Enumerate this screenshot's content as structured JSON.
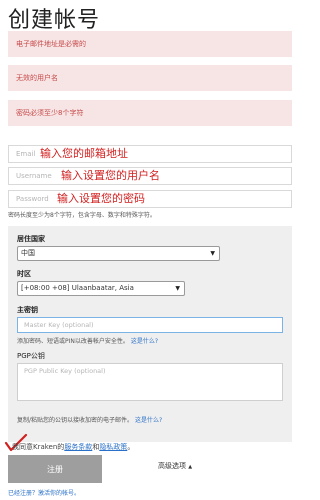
{
  "page_title": "创建帐号",
  "errors": [
    "电子邮件地址是必需的",
    "无效的用户名",
    "密码必须至少8个字符"
  ],
  "email": {
    "placeholder": "Email",
    "annotation": "输入您的邮箱地址"
  },
  "username": {
    "placeholder": "Username",
    "annotation": "输入设置您的用户名"
  },
  "password": {
    "placeholder": "Password",
    "annotation": "输入设置您的密码"
  },
  "password_hint": "密码长度至少为8个字符，包含字母、数字和特殊字符。",
  "country": {
    "label": "居住国家",
    "value": "中国"
  },
  "timezone": {
    "label": "时区",
    "value": "[+08:00 +08] Ulaanbaatar, Asia"
  },
  "master_key": {
    "label": "主密钥",
    "placeholder": "Master Key (optional)",
    "help": "添加密码、短语或PIN以改善帐户安全性。",
    "help_link": "这是什么?"
  },
  "pgp": {
    "label": "PGP公钥",
    "placeholder": "PGP Public Key (optional)",
    "help": "复制/粘贴您的公钥以接收加密的电子邮件。",
    "help_link": "这是什么?"
  },
  "agreement": {
    "prefix": "我同意Kraken的",
    "terms": "服务条款",
    "and": "和",
    "privacy": "隐私政策",
    "suffix": "。"
  },
  "submit_label": "注册",
  "advanced_label": "高级选项",
  "advanced_arrow": "▲",
  "select_arrow": "▼",
  "footer_link": "已经注册？激活你的帐号。"
}
